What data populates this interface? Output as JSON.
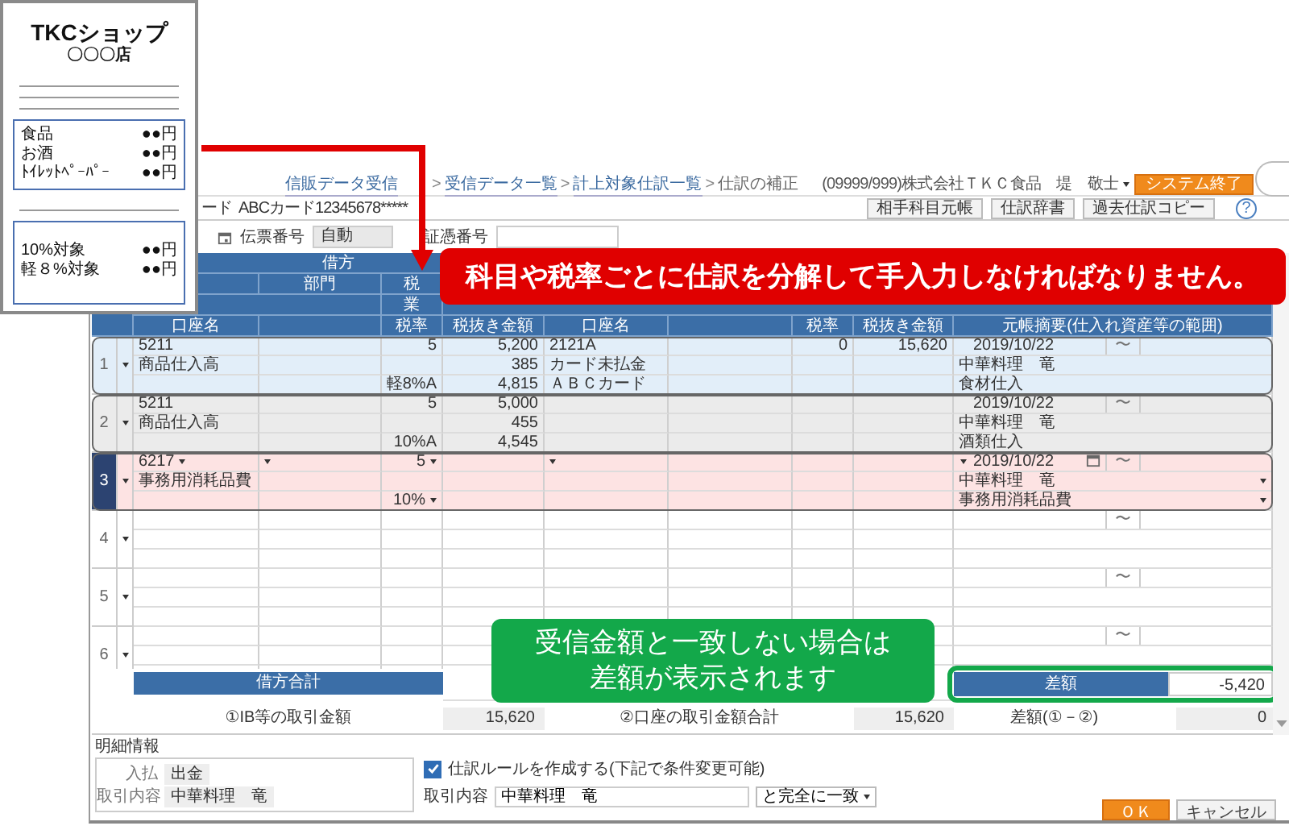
{
  "receipt": {
    "shop": "TKCショップ",
    "branch": "〇〇〇店",
    "items": [
      {
        "name": "食品",
        "amount": "●●円"
      },
      {
        "name": "お酒",
        "amount": "●●円"
      },
      {
        "name": "ﾄｲﾚｯﾄﾍﾟｰﾊﾟｰ",
        "amount": "●●円"
      }
    ],
    "tax_totals": [
      {
        "name": "10%対象",
        "amount": "●●円"
      },
      {
        "name": "軽８%対象",
        "amount": "●●円"
      }
    ]
  },
  "breadcrumb": [
    "信販データ受信",
    "受信データ一覧",
    "計上対象仕訳一覧",
    "仕訳の補正"
  ],
  "breadcrumb_separator": ">",
  "user": "(09999/999)株式会社ＴＫＣ食品　堤　敬士",
  "exit_button": "システム終了",
  "card": {
    "label": "ード",
    "value": "ABCカード12345678*****"
  },
  "toolbar_buttons": [
    "相手科目元帳",
    "仕訳辞書",
    "過去仕訳コピー"
  ],
  "help_button": "?",
  "voucher": {
    "number_label": "伝票番号",
    "number_value": "自動",
    "evidence_label": "証憑番号"
  },
  "table": {
    "group_header": "借方",
    "sub_headers": [
      "部門",
      "税",
      "業"
    ],
    "columns": [
      "口座名",
      "税率",
      "税抜き金額",
      "口座名",
      "税率",
      "税抜き金額",
      "元帳摘要(仕入れ資産等の範囲)"
    ],
    "rows": [
      {
        "number": "1",
        "selected": false,
        "color": "#e2eef9",
        "cells": [
          [
            "5211",
            null,
            "5",
            "5,200",
            "2121A",
            null,
            "0",
            "15,620"
          ],
          [
            "商品仕入高",
            null,
            null,
            "385",
            "カード未払金",
            null,
            null,
            null
          ],
          [
            null,
            null,
            "軽8%A",
            "4,815",
            "ＡＢＣカード",
            null,
            null,
            null
          ]
        ],
        "ledger": {
          "date": "2019/10/22",
          "range_mark": "〜",
          "lines": [
            "中華料理　竜",
            "食材仕入"
          ]
        }
      },
      {
        "number": "2",
        "selected": false,
        "color": "#ebebeb",
        "cells": [
          [
            "5211",
            null,
            "5",
            "5,000",
            null,
            null,
            null,
            null
          ],
          [
            "商品仕入高",
            null,
            null,
            "455",
            null,
            null,
            null,
            null
          ],
          [
            null,
            null,
            "10%A",
            "4,545",
            null,
            null,
            null,
            null
          ]
        ],
        "ledger": {
          "date": "2019/10/22",
          "range_mark": "〜",
          "lines": [
            "中華料理　竜",
            "酒類仕入"
          ]
        }
      },
      {
        "number": "3",
        "selected": true,
        "color": "#fde3e3",
        "cells": [
          [
            "6217",
            null,
            "5",
            null,
            null,
            null,
            null,
            null
          ],
          [
            "事務用消耗品費",
            null,
            null,
            null,
            null,
            null,
            null,
            null
          ],
          [
            null,
            null,
            "10%",
            null,
            null,
            null,
            null,
            null
          ]
        ],
        "ledger": {
          "date": "2019/10/22",
          "range_mark": "〜",
          "lines": [
            "中華料理　竜",
            "事務用消耗品費"
          ]
        }
      },
      {
        "number": "4",
        "selected": false,
        "ledger": {
          "range_mark": "〜"
        }
      },
      {
        "number": "5",
        "selected": false,
        "ledger": {
          "range_mark": "〜"
        }
      },
      {
        "number": "6",
        "selected": false,
        "ledger": {
          "range_mark": "〜"
        }
      }
    ],
    "debit_total_label": "借方合計"
  },
  "difference": {
    "label": "差額",
    "value": "-5,420"
  },
  "summary": [
    {
      "label": "①IB等の取引金額",
      "value": "15,620"
    },
    {
      "label": "②口座の取引金額合計",
      "value": "15,620"
    },
    {
      "label": "差額(①－②)",
      "value": "0"
    }
  ],
  "details": {
    "title": "明細情報",
    "fields": [
      {
        "label": "入払",
        "value": "出金"
      },
      {
        "label": "取引内容",
        "value": "中華料理　竜"
      }
    ],
    "rule": {
      "label": "仕訳ルールを作成する(下記で条件変更可能)",
      "checked": true
    },
    "match": {
      "label": "取引内容",
      "value": "中華料理　竜",
      "mode": "と完全に一致"
    }
  },
  "buttons": [
    "ＯＫ",
    "キャンセル"
  ],
  "callouts": {
    "warning": "科目や税率ごとに仕訳を分解して手入力しなければなりません。",
    "difference": [
      "受信金額と一致しない場合は",
      "差額が表示されます"
    ]
  }
}
